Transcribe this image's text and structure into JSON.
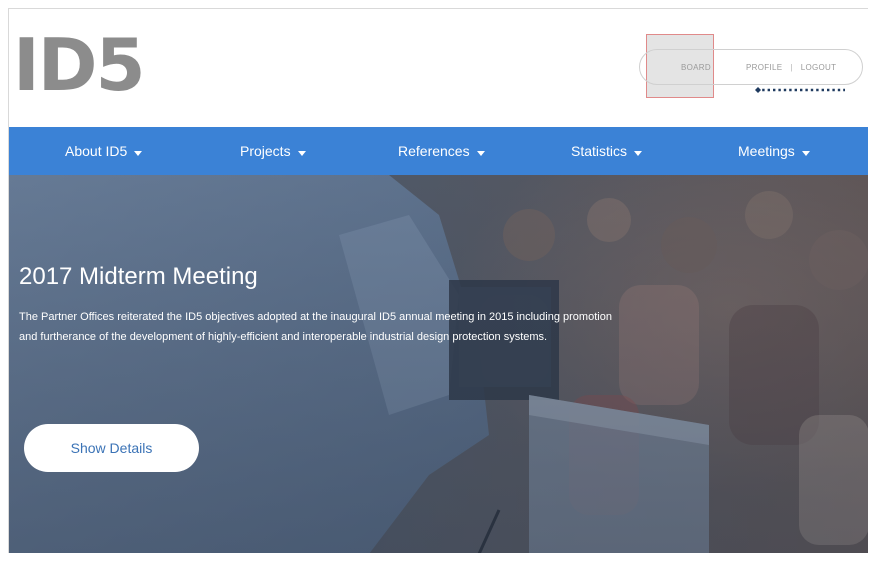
{
  "header": {
    "logo_text": "ID5",
    "account_links": {
      "board": "BOARD",
      "profile": "PROFILE",
      "separator": "|",
      "logout": "LOGOUT"
    }
  },
  "nav": {
    "items": [
      {
        "label": "About ID5"
      },
      {
        "label": "Projects"
      },
      {
        "label": "References"
      },
      {
        "label": "Statistics"
      },
      {
        "label": "Meetings"
      }
    ]
  },
  "hero": {
    "title": "2017 Midterm Meeting",
    "description": "The Partner Offices reiterated the ID5 objectives adopted at the inaugural ID5 annual meeting in 2015 including promotion and furtherance of the development of highly-efficient and interoperable industrial design protection systems.",
    "button_label": "Show Details"
  },
  "colors": {
    "nav_background": "#3b82d6",
    "logo": "#8c8c8c",
    "button_text": "#3b73b6",
    "annotation_pointer": "#1f3a5f"
  }
}
